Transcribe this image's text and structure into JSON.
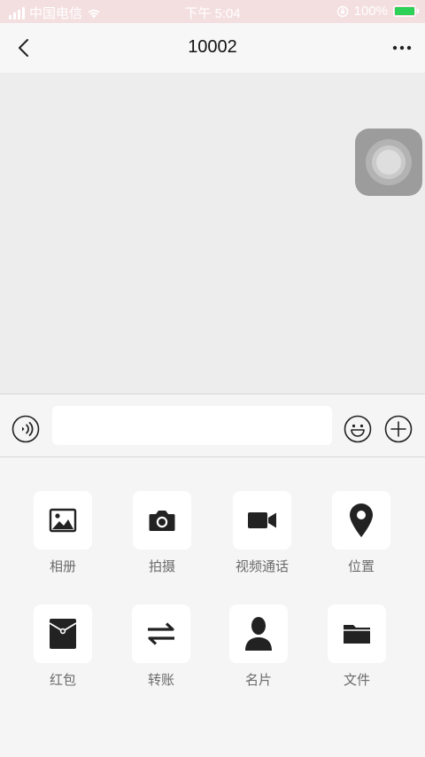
{
  "status_bar": {
    "carrier": "中国电信",
    "time": "下午 5:04",
    "battery": "100%",
    "battery_level": 1.0
  },
  "nav": {
    "title": "10002",
    "back_icon": "chevron-left-icon",
    "more_icon": "more-horizontal-icon"
  },
  "input_bar": {
    "message_value": "",
    "voice_icon": "voice-icon",
    "emoji_icon": "emoji-icon",
    "plus_icon": "plus-circle-icon"
  },
  "tools": [
    {
      "label": "相册",
      "icon": "photo-icon"
    },
    {
      "label": "拍摄",
      "icon": "camera-icon"
    },
    {
      "label": "视频通话",
      "icon": "video-call-icon"
    },
    {
      "label": "位置",
      "icon": "location-icon"
    },
    {
      "label": "红包",
      "icon": "red-packet-icon"
    },
    {
      "label": "转账",
      "icon": "transfer-icon"
    },
    {
      "label": "名片",
      "icon": "contact-card-icon"
    },
    {
      "label": "文件",
      "icon": "folder-icon"
    }
  ],
  "colors": {
    "status_bar_bg": "#f4dfe0",
    "battery_fill": "#2ed158",
    "icon_color": "#222222"
  }
}
